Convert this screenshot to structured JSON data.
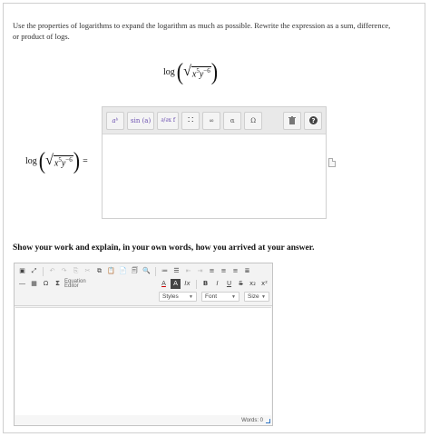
{
  "question": {
    "instructions": "Use the properties of logarithms to expand the logarithm as much as possible. Rewrite the expression as a sum, difference, or product of logs.",
    "log_word": "log",
    "radicand_base": "x",
    "radicand_exp1": "5",
    "radicand_base2": "y",
    "radicand_exp2": "−6",
    "equals": "="
  },
  "math_editor": {
    "toolbar": {
      "superscript": "aᵇ",
      "sin": "sin (a)",
      "partial": "∂/∂x f",
      "matrix": "∷",
      "infinity": "∞",
      "alpha": "α",
      "omega": "Ω",
      "trash": "🗑",
      "help": "?"
    }
  },
  "work": {
    "heading": "Show your work and explain, in your own words, how you arrived at your answer."
  },
  "rich_text_editor": {
    "equation_label_1": "Equation",
    "equation_label_2": "Editor",
    "styles_label": "Styles",
    "font_label": "Font",
    "size_label": "Size",
    "words_label": "Words: 0",
    "bold": "B",
    "italic": "I",
    "underline": "U",
    "strike": "S",
    "subscript": "x₂",
    "superscript": "x²",
    "omega": "Ω",
    "sigma": "Σ",
    "font_color": "A",
    "bg_color": "A",
    "clear_format": "Ix"
  }
}
